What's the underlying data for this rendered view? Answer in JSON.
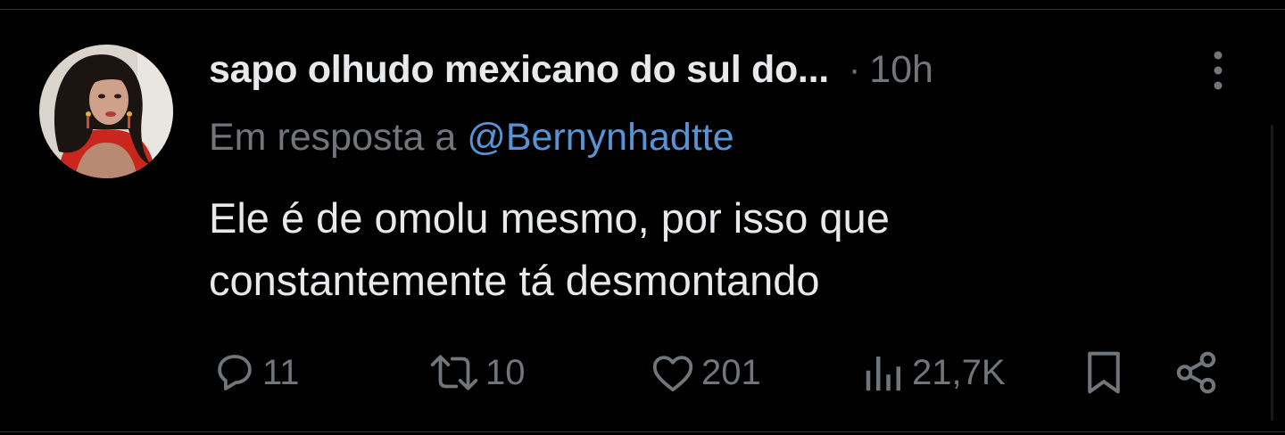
{
  "post": {
    "author_name": "sapo olhudo mexicano do sul do...",
    "separator": "·",
    "time": "10h",
    "reply_prefix": "Em resposta a ",
    "reply_handle": "@Bernynhadtte",
    "text_lines": [
      "Ele é de omolu mesmo, por isso que",
      "constantemente tá desmontando"
    ]
  },
  "actions": {
    "replies": "11",
    "reposts": "10",
    "likes": "201",
    "views": "21,7K"
  },
  "icons": {
    "more": "more-vertical-icon",
    "reply": "reply-icon",
    "repost": "repost-icon",
    "like": "heart-icon",
    "views": "views-icon",
    "bookmark": "bookmark-icon",
    "share": "share-icon"
  },
  "colors": {
    "background": "#000000",
    "text_primary": "#e7e9ea",
    "text_secondary": "#71767b",
    "link": "#5794d6",
    "divider": "#2f3336"
  }
}
